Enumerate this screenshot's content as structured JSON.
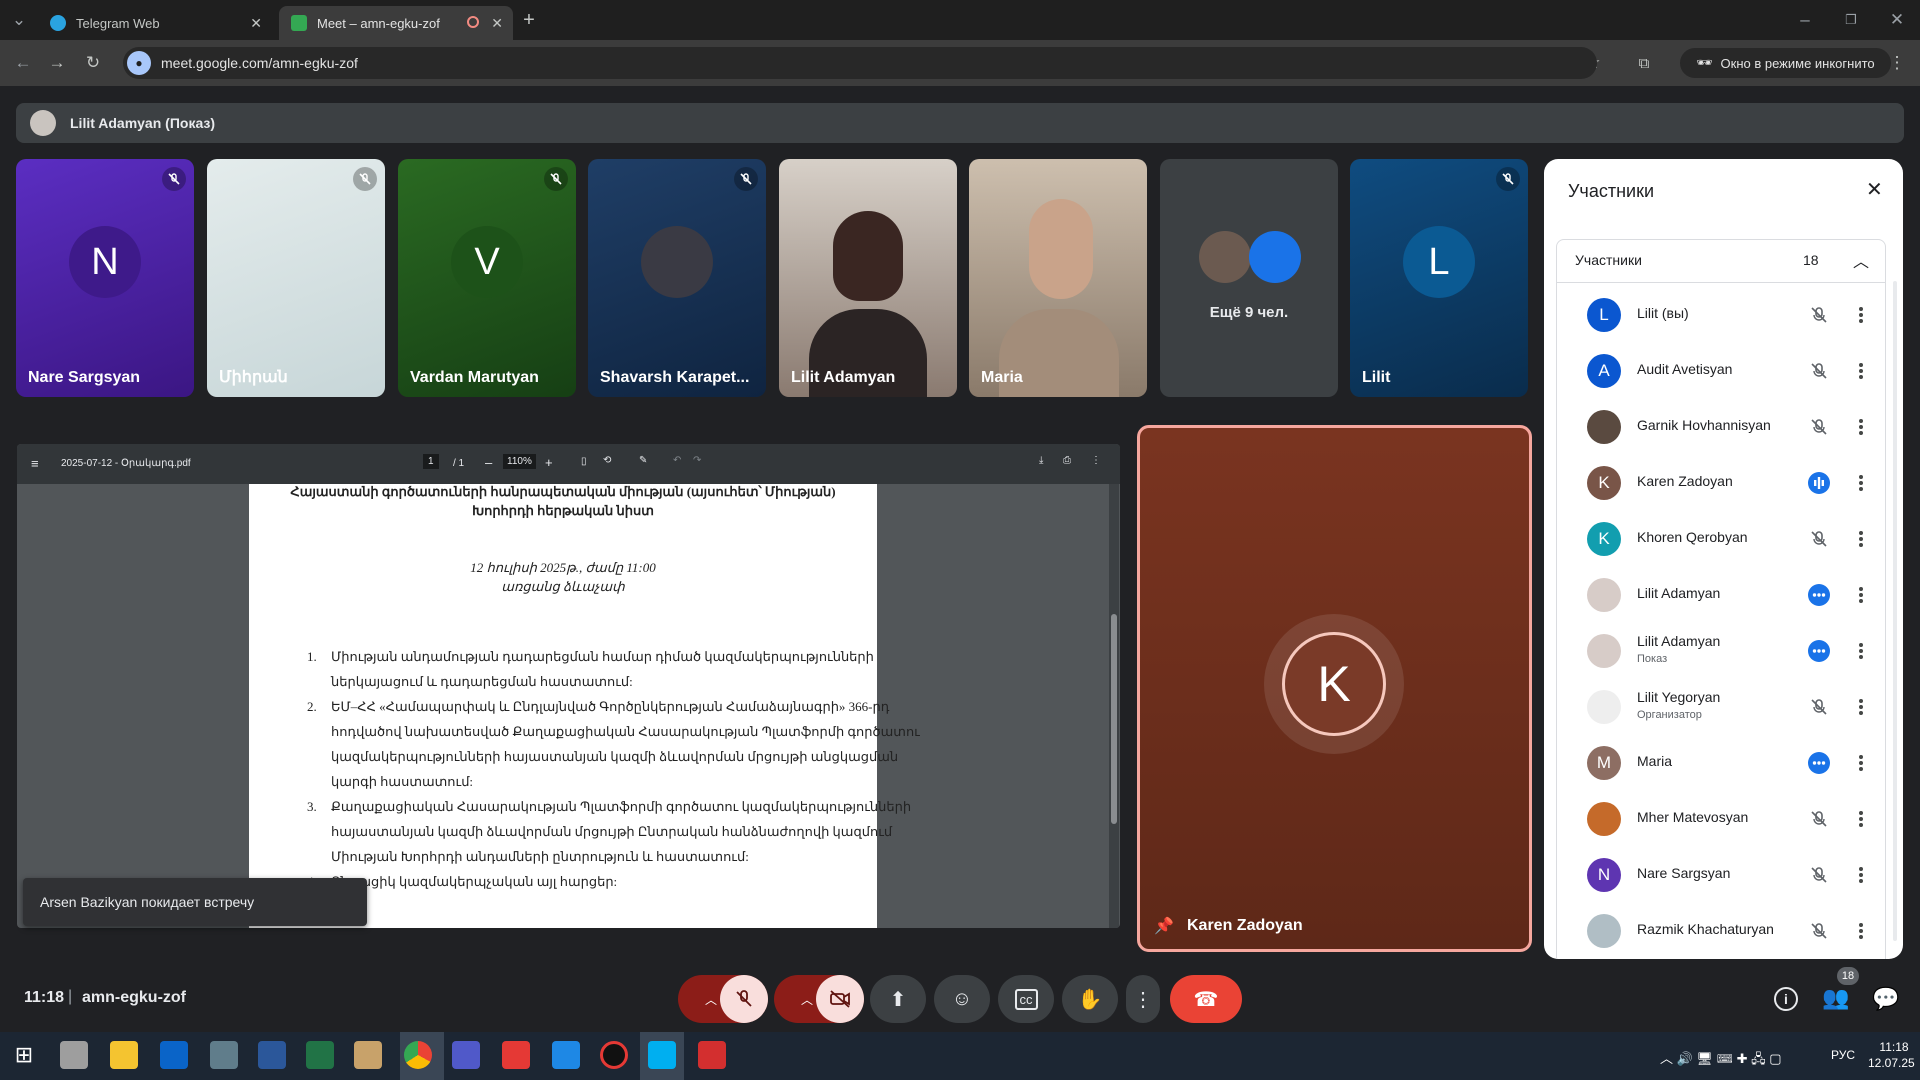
{
  "browser": {
    "tabs": [
      {
        "title": "Telegram Web",
        "active": false
      },
      {
        "title": "Meet – amn-egku-zof",
        "active": true
      }
    ],
    "url": "meet.google.com/amn-egku-zof",
    "incognito_label": "Окно в режиме инкогнито"
  },
  "meet": {
    "presenting_banner": "Lilit Adamyan (Показ)",
    "tiles": [
      {
        "name": "Nare Sargsyan",
        "initial": "N",
        "bg": "#4a1f9e",
        "muted": true
      },
      {
        "name": "Միհրան",
        "initial": "",
        "bg": "#dfe8ea",
        "muted": true
      },
      {
        "name": "Vardan Marutyan",
        "initial": "V",
        "bg": "#1e4d1c",
        "muted": true
      },
      {
        "name": "Shavarsh Karapet...",
        "initial": "",
        "bg": "#17304f",
        "muted": true
      },
      {
        "name": "Lilit Adamyan",
        "initial": "",
        "bg": "#9a8c85",
        "muted": false
      },
      {
        "name": "Maria",
        "initial": "",
        "bg": "#a69888",
        "muted": false
      },
      {
        "name": "Ещё 9 чел.",
        "initial": "",
        "bg": "#3c4043",
        "muted": false
      },
      {
        "name": "Lilit",
        "initial": "L",
        "bg": "#0d3a5c",
        "muted": true
      }
    ],
    "pdf": {
      "filename": "2025-07-12 - Օրակարգ.pdf",
      "page_current": "1",
      "page_total": "/ 1",
      "zoom": "110%",
      "lines": {
        "title1": "Հայաստանի գործատուների հանրապետական միության (այսուհետ՝ Միության)",
        "title2": "Խորհրդի հերթական նիստ",
        "date": "12 հուլիսի 2025թ., ժամը 11:00",
        "place": "առցանց ձևաչափ",
        "items": [
          [
            "Միության անդամության դադարեցման համար դիմած կազմակերպությունների",
            "ներկայացում և դադարեցման հաստատում:"
          ],
          [
            "ԵՄ–ՀՀ «Համապարփակ և Ընդլայնված Գործընկերության Համաձայնագրի» 366-րդ",
            "հոդվածով նախատեսված Քաղաքացիական Հասարակության Պլատֆորմի գործատու",
            "կազմակերպությունների հայաստանյան կազմի ձևավորման մրցույթի անցկացման",
            "կարգի հաստատում:"
          ],
          [
            "Քաղաքացիական Հասարակության Պլատֆորմի գործատու կազմակերպությունների",
            "հայաստանյան կազմի ձևավորման մրցույթի Ընտրական հանձնաժողովի կազմում",
            "Միության Խորհրդի անդամների ընտրություն և հաստատում:"
          ],
          [
            "Ընթացիկ կազմակերպչական այլ հարցեր:"
          ]
        ]
      }
    },
    "toast": "Arsen Bazikyan покидает встречу",
    "big_tile": {
      "name": "Karen Zadoyan",
      "initial": "K"
    },
    "panel": {
      "title": "Участники",
      "section_label": "Участники",
      "count": "18",
      "people": [
        {
          "name": "Lilit (вы)",
          "sub": "",
          "initial": "L",
          "color": "#0b57d0",
          "state": "muted"
        },
        {
          "name": "Audit Avetisyan",
          "sub": "",
          "initial": "A",
          "color": "#0b57d0",
          "state": "muted"
        },
        {
          "name": "Garnik Hovhannisyan",
          "sub": "",
          "initial": "",
          "color": "#5a4a40",
          "state": "muted"
        },
        {
          "name": "Karen Zadoyan",
          "sub": "",
          "initial": "K",
          "color": "#795548",
          "state": "speaking"
        },
        {
          "name": "Khoren Qerobyan",
          "sub": "",
          "initial": "K",
          "color": "#129eaf",
          "state": "muted"
        },
        {
          "name": "Lilit Adamyan",
          "sub": "",
          "initial": "",
          "color": "#d7ccc8",
          "state": "more"
        },
        {
          "name": "Lilit Adamyan",
          "sub": "Показ",
          "initial": "",
          "color": "#d7ccc8",
          "state": "more"
        },
        {
          "name": "Lilit Yegoryan",
          "sub": "Организатор",
          "initial": "",
          "color": "#eeeeee",
          "state": "muted"
        },
        {
          "name": "Maria",
          "sub": "",
          "initial": "M",
          "color": "#8d6e63",
          "state": "more"
        },
        {
          "name": "Mher Matevosyan",
          "sub": "",
          "initial": "",
          "color": "#c56a2a",
          "state": "muted"
        },
        {
          "name": "Nare Sargsyan",
          "sub": "",
          "initial": "N",
          "color": "#5e35b1",
          "state": "muted"
        },
        {
          "name": "Razmik Khachaturyan",
          "sub": "",
          "initial": "",
          "color": "#b0bec5",
          "state": "muted"
        }
      ]
    },
    "bottom": {
      "time": "11:18",
      "separator": "|",
      "meeting_code": "amn-egku-zof",
      "people_badge": "18"
    }
  },
  "taskbar": {
    "lang": "РУС",
    "time": "11:18",
    "date": "12.07.25"
  },
  "colors": {
    "accent": "#1a73e8",
    "hangup": "#ea4335",
    "panel_bg": "#ffffff"
  }
}
